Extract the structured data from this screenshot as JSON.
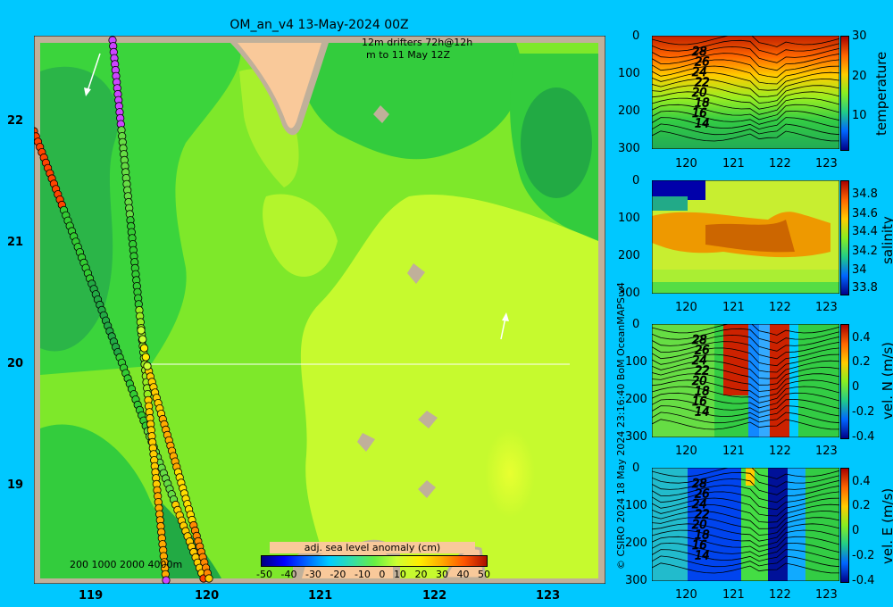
{
  "map": {
    "title": "OM_an_v4  13-May-2024 00Z",
    "legend_line1": "12m    drifters 72h@12h",
    "legend_line2": "m      to 11 May 12Z",
    "lat_ticks": [
      "22",
      "21",
      "20",
      "19"
    ],
    "lon_ticks": [
      "119",
      "120",
      "121",
      "122",
      "123"
    ],
    "depth_legend": "200  1000  2000  4000m",
    "colorbar_label": "adj. sea level anomaly (cm)",
    "colorbar_ticks": [
      "-50",
      "-40",
      "-30",
      "-20",
      "-10",
      "0",
      "10",
      "20",
      "30",
      "40",
      "50"
    ]
  },
  "credit": "© CSIRO 2024   18 May 2024 23:16:40 BoM OceanMAPS v4",
  "panels": [
    {
      "label": "temperature",
      "y_ticks": [
        "0",
        "100",
        "200",
        "300"
      ],
      "x_ticks": [
        "120",
        "121",
        "122",
        "123"
      ],
      "cb_ticks": [
        "30",
        "20",
        "10"
      ],
      "contours": [
        "28",
        "26",
        "24",
        "22",
        "20",
        "18",
        "16",
        "14"
      ]
    },
    {
      "label": "salinity",
      "y_ticks": [
        "0",
        "100",
        "200",
        "300"
      ],
      "x_ticks": [
        "120",
        "121",
        "122",
        "123"
      ],
      "cb_ticks": [
        "34.8",
        "34.6",
        "34.4",
        "34.2",
        "34",
        "33.8"
      ],
      "contours": []
    },
    {
      "label": "vel. N (m/s)",
      "y_ticks": [
        "0",
        "100",
        "200",
        "300"
      ],
      "x_ticks": [
        "120",
        "121",
        "122",
        "123"
      ],
      "cb_ticks": [
        "0.4",
        "0.2",
        "0",
        "-0.2",
        "-0.4"
      ],
      "contours": [
        "28",
        "26",
        "24",
        "22",
        "20",
        "18",
        "16",
        "14"
      ]
    },
    {
      "label": "vel. E (m/s)",
      "y_ticks": [
        "0",
        "100",
        "200",
        "300"
      ],
      "x_ticks": [
        "120",
        "121",
        "122",
        "123"
      ],
      "cb_ticks": [
        "0.4",
        "0.2",
        "0",
        "-0.2",
        "-0.4"
      ],
      "contours": [
        "28",
        "26",
        "24",
        "22",
        "20",
        "18",
        "16",
        "14"
      ]
    }
  ],
  "colors": {
    "background": "#00c8ff",
    "land": "#f9c99a",
    "coast_shelf": "#c0b09a",
    "ssh_light": "#c8ff30",
    "ssh_mid": "#80ee20",
    "ssh_low": "#33d43a",
    "ssh_lowest": "#22aa44"
  }
}
